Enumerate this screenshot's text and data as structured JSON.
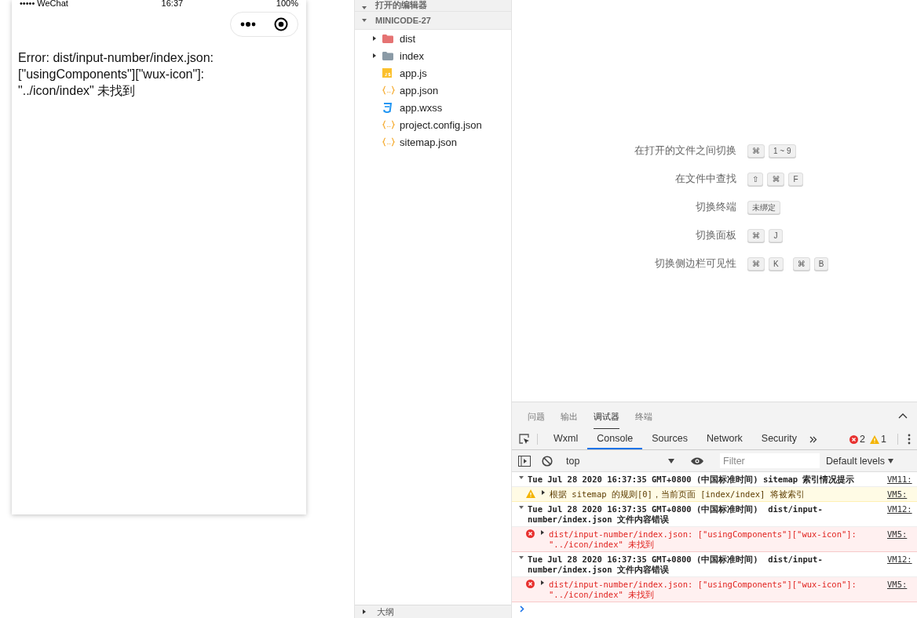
{
  "phone": {
    "status": {
      "carrier": "••••• WeChat",
      "time": "16:37",
      "battery": "100%"
    },
    "error_text": "Error: dist/input-number/index.json: [\"usingComponents\"][\"wux-icon\"]: \"../icon/index\" 未找到"
  },
  "explorer": {
    "sections": [
      {
        "title": "打开的编辑器",
        "expanded": true
      },
      {
        "title": "MINICODE-27",
        "expanded": true
      }
    ],
    "items": [
      {
        "name": "dist",
        "kind": "folder",
        "color": "#e57373",
        "expanded": false
      },
      {
        "name": "index",
        "kind": "folder",
        "color": "#8a9aa6",
        "expanded": false
      },
      {
        "name": "app.js",
        "kind": "js"
      },
      {
        "name": "app.json",
        "kind": "json"
      },
      {
        "name": "app.wxss",
        "kind": "wxss"
      },
      {
        "name": "project.config.json",
        "kind": "json"
      },
      {
        "name": "sitemap.json",
        "kind": "json"
      }
    ],
    "outline": {
      "title": "大纲",
      "expanded": false
    }
  },
  "shortcuts": [
    {
      "label": "在打开的文件之间切换",
      "keys": [
        [
          "⌘",
          "1 ~ 9"
        ]
      ]
    },
    {
      "label": "在文件中查找",
      "keys": [
        [
          "⇧",
          "⌘",
          "F"
        ]
      ]
    },
    {
      "label": "切换终端",
      "keys": [
        [
          "未绑定"
        ]
      ]
    },
    {
      "label": "切换面板",
      "keys": [
        [
          "⌘",
          "J"
        ]
      ]
    },
    {
      "label": "切换侧边栏可见性",
      "keys": [
        [
          "⌘",
          "K"
        ],
        [
          "⌘",
          "B"
        ]
      ]
    }
  ],
  "panel": {
    "tabs": [
      {
        "label": "问题",
        "selected": false
      },
      {
        "label": "输出",
        "selected": false
      },
      {
        "label": "调试器",
        "selected": true
      },
      {
        "label": "终端",
        "selected": false
      }
    ],
    "devtools_tabs": [
      {
        "label": "Wxml",
        "selected": false
      },
      {
        "label": "Console",
        "selected": true
      },
      {
        "label": "Sources",
        "selected": false
      },
      {
        "label": "Network",
        "selected": false
      },
      {
        "label": "Security",
        "selected": false
      }
    ],
    "error_count": "2",
    "warning_count": "1",
    "context": "top",
    "filter": {
      "placeholder": "Filter"
    },
    "levels": "Default levels"
  },
  "console": [
    {
      "kind": "group",
      "text": "Tue Jul 28 2020 16:37:35 GMT+0800 (中国标准时间) sitemap 索引情况提示",
      "source": "VM11:"
    },
    {
      "kind": "warning",
      "text": "根据 sitemap 的规则[0]，当前页面 [index/index] 将被索引",
      "source": "VM5:"
    },
    {
      "kind": "group",
      "text": "Tue Jul 28 2020 16:37:35 GMT+0800 (中国标准时间)  dist/input-number/index.json 文件内容错误",
      "source": "VM12:"
    },
    {
      "kind": "error",
      "text": "dist/input-number/index.json: [\"usingComponents\"][\"wux-icon\"]: \"../icon/index\" 未找到",
      "source": "VM5:"
    },
    {
      "kind": "group",
      "text": "Tue Jul 28 2020 16:37:35 GMT+0800 (中国标准时间)  dist/input-number/index.json 文件内容错误",
      "source": "VM12:"
    },
    {
      "kind": "error",
      "text": "dist/input-number/index.json: [\"usingComponents\"][\"wux-icon\"]: \"../icon/index\" 未找到",
      "source": "VM5:"
    }
  ]
}
